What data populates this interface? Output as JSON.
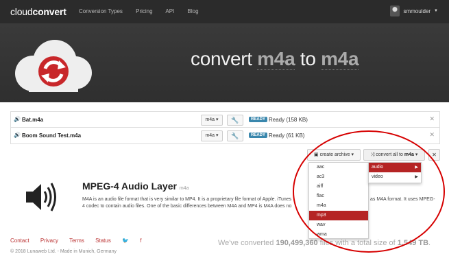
{
  "brand": {
    "name_light": "cloud",
    "name_bold": "convert"
  },
  "nav": {
    "items": [
      "Conversion Types",
      "Pricing",
      "API",
      "Blog"
    ]
  },
  "user": {
    "name": "smmoulder"
  },
  "hero": {
    "title_prefix": "convert ",
    "from_fmt": "m4a",
    "title_mid": " to ",
    "to_fmt": "m4a"
  },
  "files": [
    {
      "name": "Bat.m4a",
      "format": "m4a",
      "badge": "READY",
      "status": "Ready (158 KB)"
    },
    {
      "name": "Boom Sound Test.m4a",
      "format": "m4a",
      "badge": "READY",
      "status": "Ready (61 KB)"
    }
  ],
  "actions": {
    "archive": "create archive",
    "convert_all": "convert all to",
    "convert_all_fmt": "m4a"
  },
  "format_info": {
    "title": "MPEG-4 Audio Layer",
    "tag": "m4a",
    "desc": "M4A is an audio file format that is very similar to MP4. It is a proprietary file format of Apple. iTunes",
    "desc2": "4 codec to contain audio files. One of the basic differences between M4A and MP4 is M4A does no",
    "desc_right": "as M4A format. It uses MPEG-"
  },
  "dropdown": {
    "items": [
      "aac",
      "ac3",
      "aiff",
      "flac",
      "m4a",
      "mp3",
      "wav",
      "wma"
    ],
    "selected": "mp3",
    "categories": [
      "audio",
      "video"
    ],
    "active_category": "audio"
  },
  "footer": {
    "links": [
      "Contact",
      "Privacy",
      "Terms",
      "Status"
    ],
    "copyright": "© 2018 Lunaweb Ltd. - Made in Munich, Germany",
    "stats_prefix": "We've converted ",
    "stats_files": "190,499,360",
    "stats_mid": " files with a total size of ",
    "stats_size": "1,549 TB",
    "stats_suffix": "."
  },
  "colors": {
    "accent": "#b52424",
    "badge": "#3a87ad",
    "header_bg": "#2b2b2b",
    "hero_bg": "#333333",
    "annotation": "#d60000"
  }
}
